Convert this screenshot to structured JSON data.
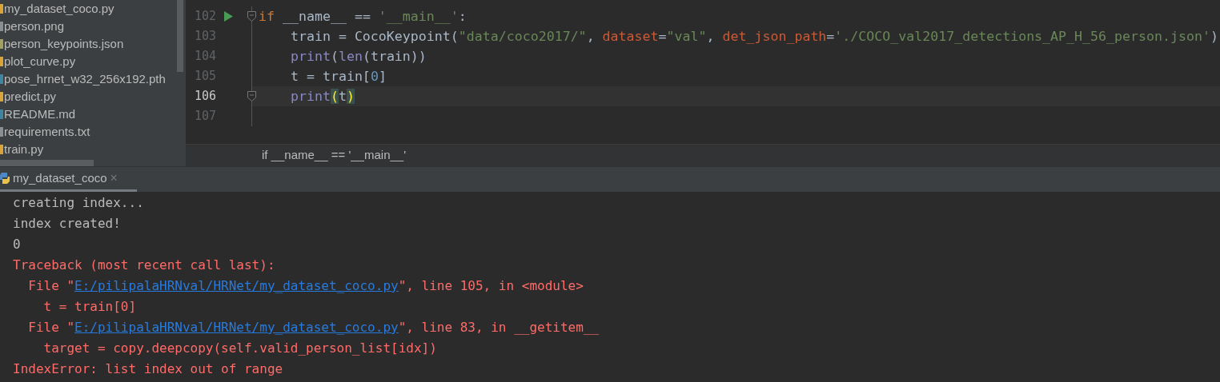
{
  "project_tree": {
    "items": [
      {
        "label": "my_dataset_coco.py",
        "kind": "python"
      },
      {
        "label": "person.png",
        "kind": "image"
      },
      {
        "label": "person_keypoints.json",
        "kind": "json"
      },
      {
        "label": "plot_curve.py",
        "kind": "python"
      },
      {
        "label": "pose_hrnet_w32_256x192.pth",
        "kind": "binary"
      },
      {
        "label": "predict.py",
        "kind": "python"
      },
      {
        "label": "README.md",
        "kind": "markdown"
      },
      {
        "label": "requirements.txt",
        "kind": "text"
      },
      {
        "label": "train.py",
        "kind": "python"
      }
    ]
  },
  "editor": {
    "lines": [
      {
        "number": "102",
        "current": false,
        "run": true,
        "fold": true,
        "tokens": [
          {
            "kind": "keyword",
            "text": "if"
          },
          {
            "kind": "plain",
            "text": " __name__ == "
          },
          {
            "kind": "string",
            "text": "'__main__'"
          },
          {
            "kind": "plain",
            "text": ":"
          }
        ]
      },
      {
        "number": "103",
        "current": false,
        "run": false,
        "fold": false,
        "tokens": [
          {
            "kind": "plain",
            "text": "    train = CocoKeypoint("
          },
          {
            "kind": "string",
            "text": "\"data/coco2017/\""
          },
          {
            "kind": "plain",
            "text": ", "
          },
          {
            "kind": "param",
            "text": "dataset"
          },
          {
            "kind": "plain",
            "text": "="
          },
          {
            "kind": "string",
            "text": "\"val\""
          },
          {
            "kind": "plain",
            "text": ", "
          },
          {
            "kind": "param",
            "text": "det_json_path"
          },
          {
            "kind": "plain",
            "text": "="
          },
          {
            "kind": "string",
            "text": "'./COCO_val2017_detections_AP_H_56_person.json'"
          },
          {
            "kind": "plain",
            "text": ")"
          }
        ]
      },
      {
        "number": "104",
        "current": false,
        "run": false,
        "fold": false,
        "tokens": [
          {
            "kind": "builtin",
            "text": "    print"
          },
          {
            "kind": "plain",
            "text": "("
          },
          {
            "kind": "builtin",
            "text": "len"
          },
          {
            "kind": "plain",
            "text": "(train))"
          }
        ]
      },
      {
        "number": "105",
        "current": false,
        "run": false,
        "fold": false,
        "tokens": [
          {
            "kind": "plain",
            "text": "    t = train["
          },
          {
            "kind": "number",
            "text": "0"
          },
          {
            "kind": "plain",
            "text": "]"
          }
        ]
      },
      {
        "number": "106",
        "current": true,
        "run": false,
        "fold": true,
        "tokens": [
          {
            "kind": "builtin",
            "text": "    print"
          },
          {
            "kind": "brace_match",
            "text": "("
          },
          {
            "kind": "plain",
            "text": "t"
          },
          {
            "kind": "brace_match",
            "text": ")"
          }
        ]
      },
      {
        "number": "107",
        "current": false,
        "run": false,
        "fold": false
      }
    ],
    "breadcrumb": "if __name__ == '__main__'"
  },
  "run_panel": {
    "tabs": [
      {
        "label": "my_dataset_coco",
        "close": "×",
        "selected": true
      }
    ],
    "console": [
      {
        "tokens": [
          {
            "kind": "output",
            "text": "creating index..."
          }
        ]
      },
      {
        "tokens": [
          {
            "kind": "output",
            "text": "index created!"
          }
        ]
      },
      {
        "tokens": [
          {
            "kind": "output",
            "text": "0"
          }
        ]
      },
      {
        "tokens": [
          {
            "kind": "error",
            "text": "Traceback (most recent call last):"
          }
        ]
      },
      {
        "tokens": [
          {
            "kind": "error",
            "text": "  File \""
          },
          {
            "kind": "link",
            "text": "E:/pilipalaHRNval/HRNet/my_dataset_coco.py"
          },
          {
            "kind": "error",
            "text": "\", line 105, in <module>"
          }
        ]
      },
      {
        "tokens": [
          {
            "kind": "error",
            "text": "    t = train[0]"
          }
        ]
      },
      {
        "tokens": [
          {
            "kind": "error",
            "text": "  File \""
          },
          {
            "kind": "link",
            "text": "E:/pilipalaHRNval/HRNet/my_dataset_coco.py"
          },
          {
            "kind": "error",
            "text": "\", line 83, in __getitem__"
          }
        ]
      },
      {
        "tokens": [
          {
            "kind": "error",
            "text": "    target = copy.deepcopy(self.valid_person_list[idx])"
          }
        ]
      },
      {
        "tokens": [
          {
            "kind": "error",
            "text": "IndexError: list index out of range"
          }
        ]
      }
    ]
  }
}
